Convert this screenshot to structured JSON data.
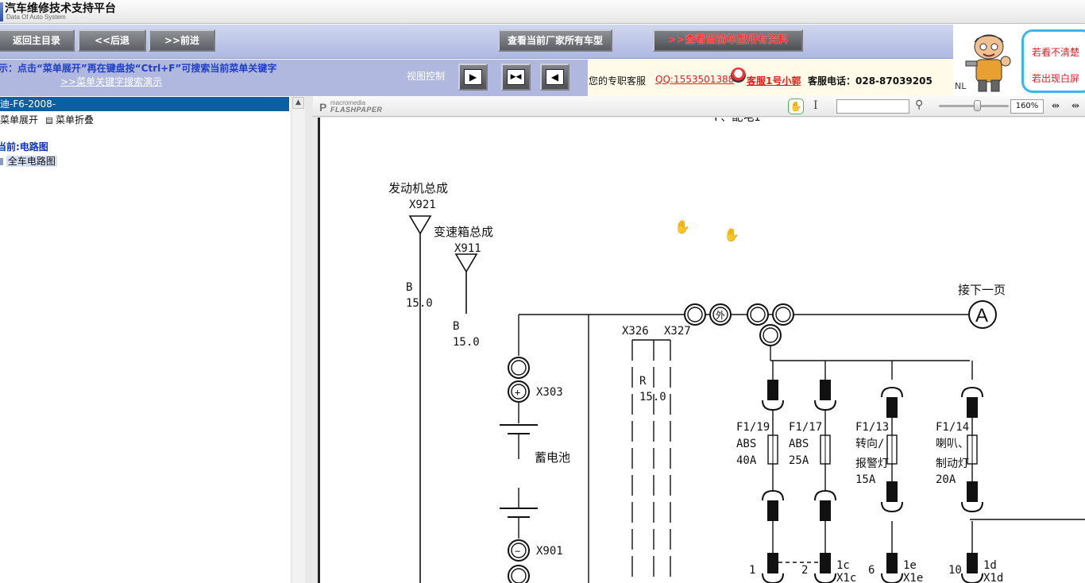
{
  "app": {
    "title": "汽车维修技术支持平台",
    "subtitle": "Data Of Auto System"
  },
  "nav": {
    "home": "返回主目录",
    "back": "<<后退",
    "forward": ">>前进",
    "all_models": "查看当前厂家所有车型",
    "all_data_arrow": ">>",
    "all_data": "查看当前车型所有资料"
  },
  "hint": {
    "text": "示：点击“菜单展开”再在键盘按“Ctrl+F”可搜索当前菜单关键字",
    "link": ">>菜单关键字搜索演示"
  },
  "view_control": {
    "label": "视图控制",
    "btn1": "▶",
    "btn2": "▶◀",
    "btn3": "◀"
  },
  "contact": {
    "prefix": "您的专职客服",
    "qq": "QQ:1553501388",
    "agent": "客服1号小郭",
    "phone": "客服电话：028-87039205"
  },
  "ad": {
    "line1": "若看不清楚",
    "line2": "若出现白屏",
    "nl": "NL"
  },
  "left_panel": {
    "header": "迪-F6-2008-",
    "expand": "菜单展开",
    "collapse": "菜单折叠",
    "current": "当前:电路图",
    "item": "全车电路图"
  },
  "viewer": {
    "logo_top": "macromedia",
    "logo_bottom": "FLASHPAPER",
    "logo_p": "P",
    "search_value": "",
    "zoom": "160%",
    "hand_icon": "✋",
    "text_icon": "I",
    "search_icon": "⚲",
    "fit_width_icon": "⇹",
    "fit_page_icon": "⇹"
  },
  "diagram": {
    "top_cut": "F、配电I",
    "engine": "发动机总成",
    "x921": "X921",
    "gearbox": "变速箱总成",
    "x911": "X911",
    "b1": "B",
    "b1v": "15.0",
    "b2": "B",
    "b2v": "15.0",
    "x326": "X326",
    "x327": "X327",
    "r": "R",
    "rv": "15.0",
    "x303": "X303",
    "plus": "+",
    "minus": "−",
    "battery": "蓄电池",
    "x901": "X901",
    "outside": "外",
    "next_page": "接下一页",
    "connector_a": "A",
    "fuses": [
      {
        "id": "F1/19",
        "name": "ABS",
        "amp": "40A",
        "pin": "1",
        "conn": ""
      },
      {
        "id": "F1/17",
        "name": "ABS",
        "amp": "25A",
        "pin": "2",
        "conn": "1c X1c"
      },
      {
        "id": "F1/13",
        "name": "转向/",
        "name2": "报警灯",
        "amp": "15A",
        "pin": "6",
        "conn": "1e X1e"
      },
      {
        "id": "F1/14",
        "name": "喇叭、",
        "name2": "制动灯",
        "amp": "20A",
        "pin": "10",
        "conn": "1d X1d"
      }
    ]
  }
}
